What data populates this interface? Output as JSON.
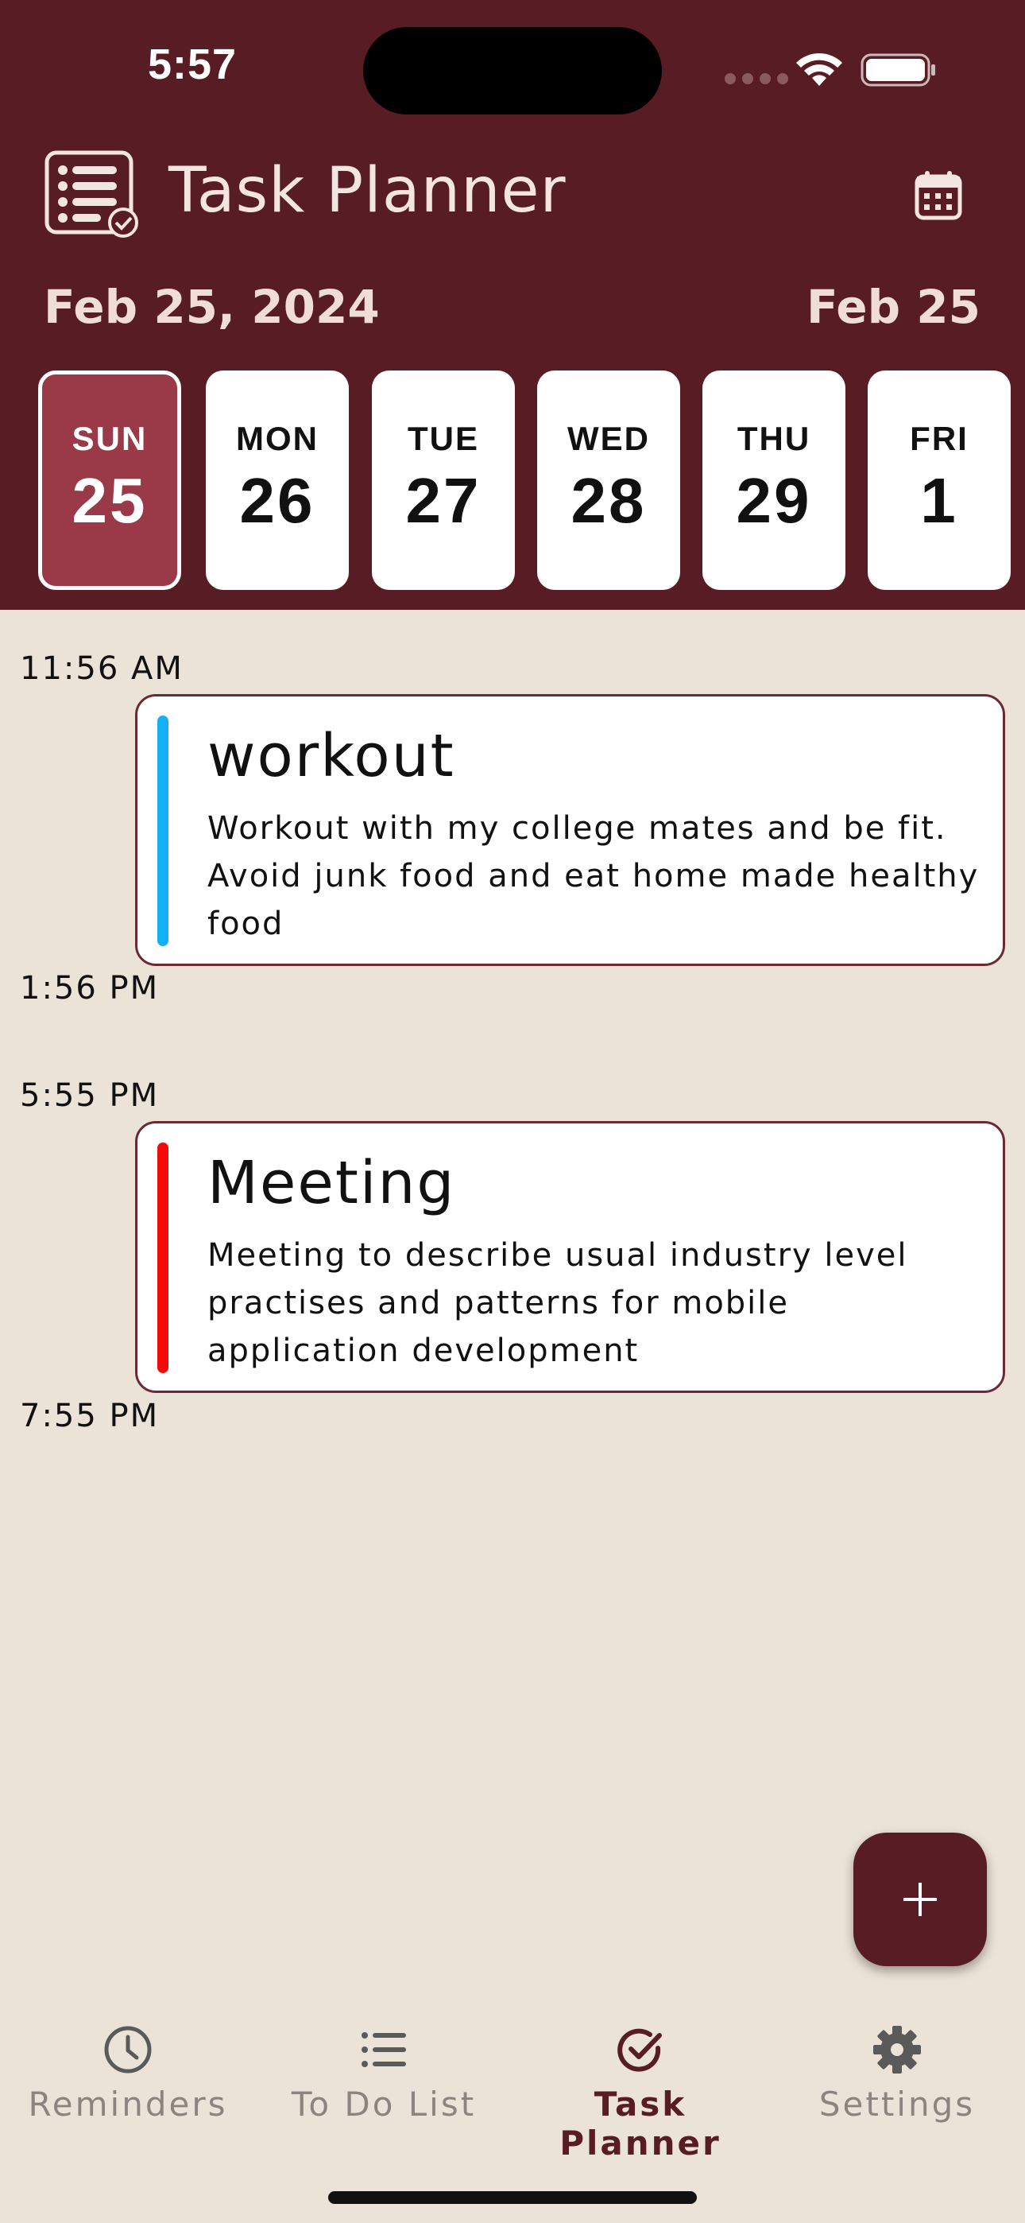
{
  "status_bar": {
    "time": "5:57"
  },
  "header": {
    "title": "Task Planner",
    "date_full": "Feb 25, 2024",
    "date_short": "Feb 25",
    "logo_icon": "checklist-icon",
    "calendar_icon": "calendar-icon"
  },
  "days": [
    {
      "name": "SUN",
      "num": "25",
      "selected": true
    },
    {
      "name": "MON",
      "num": "26",
      "selected": false
    },
    {
      "name": "TUE",
      "num": "27",
      "selected": false
    },
    {
      "name": "WED",
      "num": "28",
      "selected": false
    },
    {
      "name": "THU",
      "num": "29",
      "selected": false
    },
    {
      "name": "FRI",
      "num": "1",
      "selected": false
    }
  ],
  "tasks": [
    {
      "start": "11:56 AM",
      "end": "1:56 PM",
      "title": "workout",
      "description": "Workout with my college mates and be fit. Avoid junk food and eat home made healthy food",
      "color": "#13B0F5"
    },
    {
      "start": "5:55 PM",
      "end": "7:55 PM",
      "title": "Meeting",
      "description": "Meeting to describe usual industry level practises and patterns for mobile application development",
      "color": "#F50A0A"
    }
  ],
  "fab": {
    "icon": "plus-icon"
  },
  "nav": [
    {
      "label": "Reminders",
      "icon": "clock-icon",
      "active": false
    },
    {
      "label": "To Do List",
      "icon": "list-icon",
      "active": false
    },
    {
      "label": "Task Planner",
      "icon": "check-circle-icon",
      "active": true
    },
    {
      "label": "Settings",
      "icon": "gear-icon",
      "active": false
    }
  ],
  "colors": {
    "primary": "#581C24",
    "selected_day": "#9A3A48",
    "background": "#ECE3D8",
    "nav_inactive": "#8C8480"
  }
}
